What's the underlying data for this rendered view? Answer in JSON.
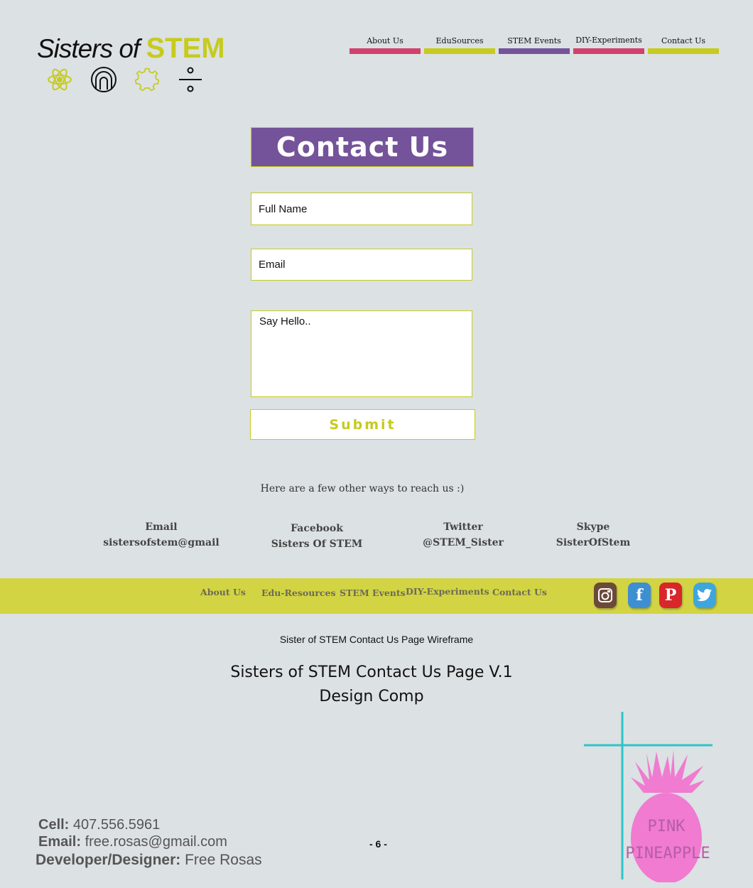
{
  "logo": {
    "text_main": "Sisters of ",
    "text_accent": "STEM",
    "accent_color": "#c6cb1e",
    "icons": [
      "atom-icon",
      "lightbulb-icon",
      "gear-icon",
      "divide-icon"
    ]
  },
  "top_nav": [
    {
      "label": "About Us",
      "color": "#d1416c"
    },
    {
      "label": "EduSources",
      "color": "#c6cb1e"
    },
    {
      "label": "STEM Events",
      "color": "#74539a"
    },
    {
      "label": "DIY-Experiments",
      "color": "#d1416c"
    },
    {
      "label": "Contact Us",
      "color": "#c6cb1e"
    }
  ],
  "contact": {
    "title": "Contact Us",
    "name_placeholder": "Full Name",
    "email_placeholder": "Email",
    "message_placeholder": "Say Hello..",
    "submit_label": "Submit",
    "reach_text": "Here are a few other ways to reach us :)"
  },
  "other_contacts": [
    {
      "label": "Email",
      "value": "sistersofstem@gmail"
    },
    {
      "label": "Facebook",
      "value": "Sisters Of STEM"
    },
    {
      "label": "Twitter",
      "value": "@STEM_Sister"
    },
    {
      "label": "Skype",
      "value": "SisterOfStem"
    }
  ],
  "footer": {
    "nav": [
      "About Us",
      "Edu-Resources",
      "STEM Events",
      "DIY-Experiments",
      "Contact Us"
    ],
    "social": [
      "instagram-icon",
      "facebook-icon",
      "pinterest-icon",
      "twitter-icon"
    ],
    "bar_color": "#d2d443"
  },
  "meta": {
    "wireframe_label": "Sister of STEM Contact Us Page Wireframe",
    "comp_title_line1": "Sisters of STEM Contact Us Page V.1",
    "comp_title_line2": "Design Comp",
    "cell_label": "Cell:",
    "cell_value": "407.556.5961",
    "email_label": "Email:",
    "email_value": "free.rosas@gmail.com",
    "dev_label": "Developer/Designer:",
    "dev_value": "Free Rosas",
    "page_number": "- 6 -",
    "brand_line1": "PINK",
    "brand_line2": "PINEAPPLE"
  }
}
